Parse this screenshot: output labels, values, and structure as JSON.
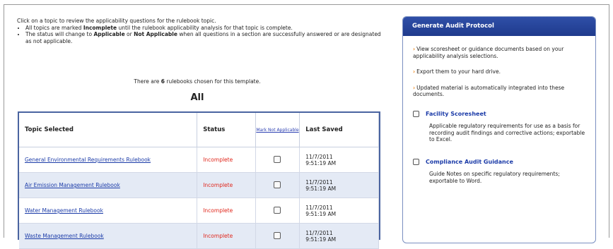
{
  "intro": {
    "lead": "Click on a topic to review the applicability questions for the rulebook topic.",
    "bullet1_pre": "All topics are marked ",
    "bullet1_bold": "Incomplete",
    "bullet1_post": " until the rulebook applicability analysis for that topic is complete.",
    "bullet2_pre": "The status will change to ",
    "bullet2_bold1": "Applicable",
    "bullet2_mid": " or ",
    "bullet2_bold2": "Not Applicable",
    "bullet2_post": " when all questions in a section are successfully answered or are designated as not applicable."
  },
  "rulebook_count": {
    "pre": "There are ",
    "count": "6",
    "post": " rulebooks chosen for this template."
  },
  "filter_title": "All",
  "table": {
    "headers": {
      "topic": "Topic Selected",
      "status": "Status",
      "mark": "Mark Not Applicable",
      "saved": "Last Saved"
    },
    "rows": [
      {
        "topic": "General Environmental Requirements Rulebook",
        "status": "Incomplete",
        "date": "11/7/2011",
        "time": "9:51:19 AM"
      },
      {
        "topic": "Air Emission Management Rulebook",
        "status": "Incomplete",
        "date": "11/7/2011",
        "time": "9:51:19 AM"
      },
      {
        "topic": "Water Management Rulebook",
        "status": "Incomplete",
        "date": "11/7/2011",
        "time": "9:51:19 AM"
      },
      {
        "topic": "Waste Management Rulebook",
        "status": "Incomplete",
        "date": "11/7/2011",
        "time": "9:51:19 AM"
      }
    ]
  },
  "panel": {
    "title": "Generate Audit Protocol",
    "bullets": [
      "View scoresheet or guidance documents based on your applicability analysis selections.",
      "Export them to your hard drive.",
      "Updated material is automatically integrated into these documents."
    ],
    "options": [
      {
        "title": "Facility Scoresheet",
        "desc": "Applicable regulatory requirements for use as a basis for recording audit findings and corrective actions; exportable to Excel."
      },
      {
        "title": "Compliance Audit Guidance",
        "desc": "Guide Notes on specific regulatory requirements; exportable to Word."
      }
    ]
  },
  "colors": {
    "panel_header": "#2f4fa8",
    "status_incomplete": "#e0261b",
    "link": "#1b3ba8",
    "arrow": "#f08a1f",
    "row_alt": "#e4eaf5"
  }
}
